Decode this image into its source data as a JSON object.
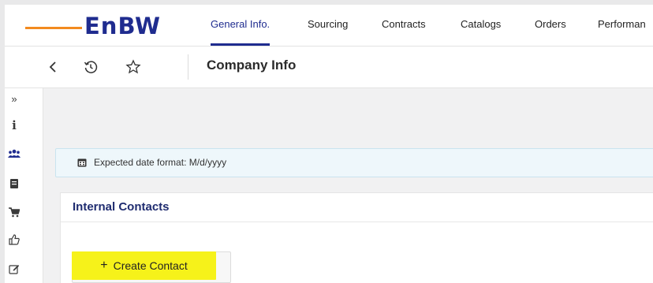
{
  "brand": {
    "logo_text": "EnBW"
  },
  "nav": {
    "tabs": [
      {
        "label": "General Info.",
        "active": true
      },
      {
        "label": "Sourcing",
        "active": false
      },
      {
        "label": "Contracts",
        "active": false
      },
      {
        "label": "Catalogs",
        "active": false
      },
      {
        "label": "Orders",
        "active": false
      },
      {
        "label": "Performan",
        "active": false
      }
    ]
  },
  "header": {
    "title": "Company Info",
    "icons": [
      "back-arrow-icon",
      "history-icon",
      "star-icon"
    ]
  },
  "sidebar": {
    "items": [
      {
        "icon": "expand-chevrons-icon",
        "glyph": "»"
      },
      {
        "icon": "info-icon",
        "glyph": "i"
      },
      {
        "icon": "contacts-icon",
        "glyph": ""
      },
      {
        "icon": "document-icon",
        "glyph": ""
      },
      {
        "icon": "cart-icon",
        "glyph": ""
      },
      {
        "icon": "thumbs-up-icon",
        "glyph": ""
      },
      {
        "icon": "edit-icon",
        "glyph": ""
      }
    ]
  },
  "banner": {
    "icon": "calendar-icon",
    "text": "Expected date format: M/d/yyyy"
  },
  "contacts": {
    "title": "Internal Contacts",
    "create_button": {
      "icon": "plus-icon",
      "label": "Create Contact"
    }
  },
  "colors": {
    "brand_blue": "#1f2c8f",
    "brand_orange": "#f28a1f",
    "highlight_yellow": "#f6f21a",
    "banner_bg": "#eef7fb"
  }
}
